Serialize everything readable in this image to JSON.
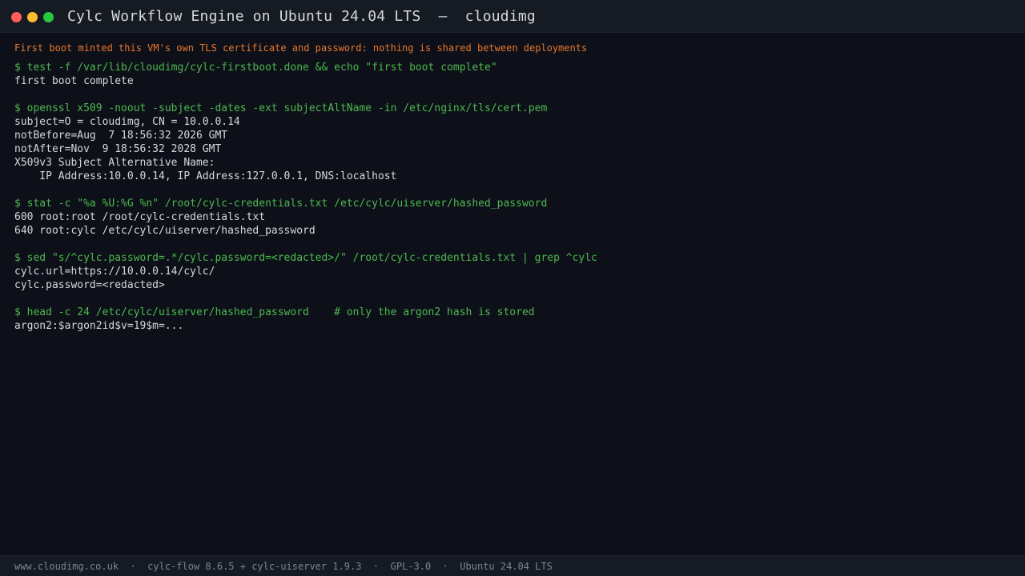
{
  "window": {
    "title": "Cylc Workflow Engine on Ubuntu 24.04 LTS  –  cloudimg",
    "controls": {
      "close_color": "#ff5f57",
      "minimize_color": "#febc2e",
      "maximize_color": "#28c840"
    }
  },
  "terminal": {
    "banner": "First boot minted this VM's own TLS certificate and password: nothing is shared between deployments",
    "blocks": [
      {
        "command": "$ test -f /var/lib/cloudimg/cylc-firstboot.done && echo \"first boot complete\"",
        "output": [
          "first boot complete"
        ]
      },
      {
        "command": "$ openssl x509 -noout -subject -dates -ext subjectAltName -in /etc/nginx/tls/cert.pem",
        "output": [
          "subject=O = cloudimg, CN = 10.0.0.14",
          "notBefore=Aug  7 18:56:32 2026 GMT",
          "notAfter=Nov  9 18:56:32 2028 GMT",
          "X509v3 Subject Alternative Name:",
          "    IP Address:10.0.0.14, IP Address:127.0.0.1, DNS:localhost"
        ]
      },
      {
        "command": "$ stat -c \"%a %U:%G %n\" /root/cylc-credentials.txt /etc/cylc/uiserver/hashed_password",
        "output": [
          "600 root:root /root/cylc-credentials.txt",
          "640 root:cylc /etc/cylc/uiserver/hashed_password"
        ]
      },
      {
        "command": "$ sed \"s/^cylc.password=.*/cylc.password=<redacted>/\" /root/cylc-credentials.txt | grep ^cylc",
        "output": [
          "cylc.url=https://10.0.0.14/cylc/",
          "cylc.password=<redacted>"
        ]
      },
      {
        "command": "$ head -c 24 /etc/cylc/uiserver/hashed_password    # only the argon2 hash is stored",
        "output": [
          "argon2:$argon2id$v=19$m=..."
        ]
      }
    ]
  },
  "footer": {
    "text": "www.cloudimg.co.uk  ·  cylc-flow 8.6.5 + cylc-uiserver 1.9.3  ·  GPL-3.0  ·  Ubuntu 24.04 LTS"
  },
  "colors": {
    "background": "#0d1018",
    "titlebar": "#161a23",
    "command": "#4db84f",
    "output": "#d4d8df",
    "banner": "#e8772e",
    "footer_text": "#7d8490"
  }
}
